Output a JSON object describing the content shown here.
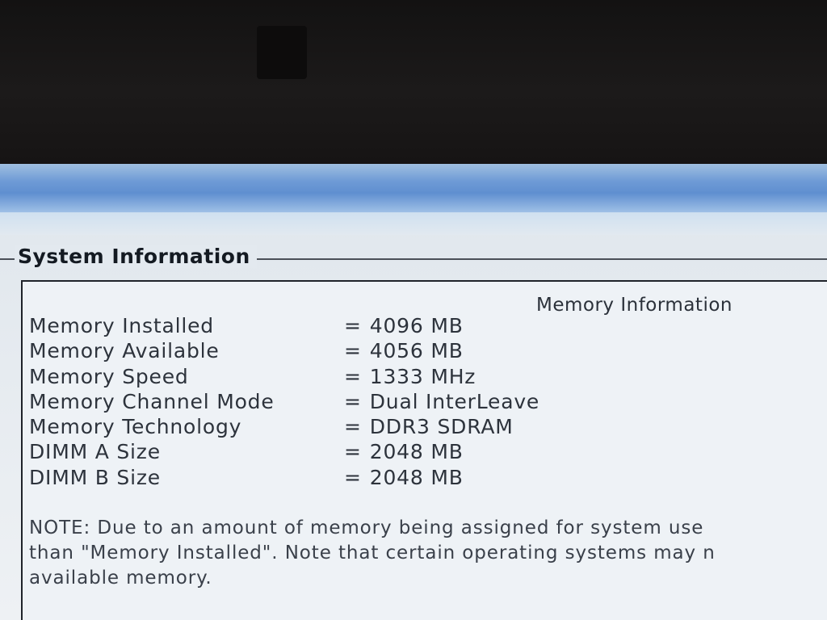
{
  "group": {
    "title": "System Information"
  },
  "section": {
    "title": "Memory Information"
  },
  "memory_rows": [
    {
      "label": "Memory Installed",
      "value": "4096 MB"
    },
    {
      "label": "Memory Available",
      "value": "4056 MB"
    },
    {
      "label": "Memory Speed",
      "value": "1333 MHz"
    },
    {
      "label": "Memory Channel Mode",
      "value": "Dual InterLeave"
    },
    {
      "label": "Memory Technology",
      "value": "DDR3 SDRAM"
    },
    {
      "label": "DIMM A Size",
      "value": "2048 MB"
    },
    {
      "label": "DIMM B Size",
      "value": "2048 MB"
    }
  ],
  "equals_sign": "=",
  "note": {
    "lines": [
      "NOTE: Due to an amount of memory being assigned for system use",
      "than \"Memory Installed\". Note that certain operating systems may n",
      "available memory."
    ]
  },
  "colors": {
    "title_bar": "#5f8fd0",
    "background": "#e6ebf0",
    "text": "#2d333c",
    "bezel": "#1c1a1a"
  }
}
